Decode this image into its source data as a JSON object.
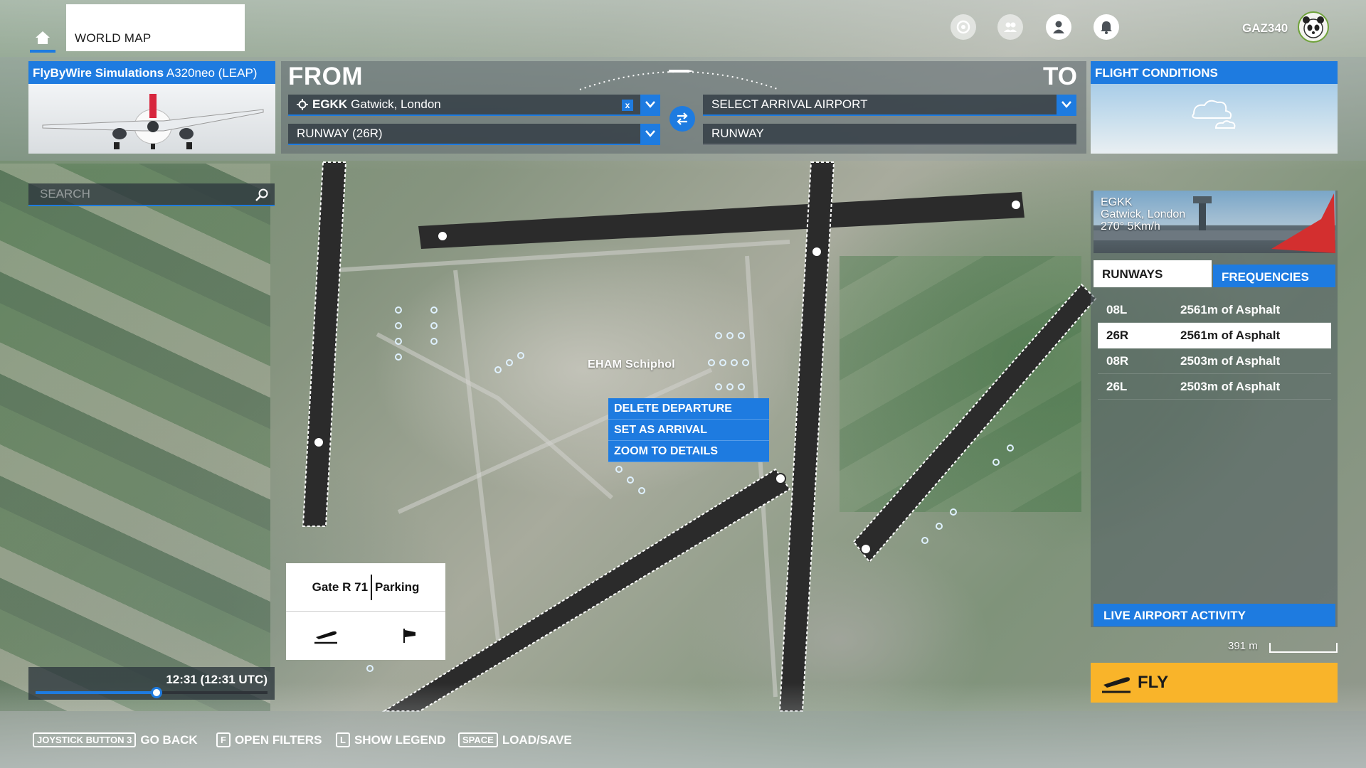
{
  "topbar": {
    "home_icon": "home-icon",
    "section_title": "WORLD MAP",
    "icons": [
      "achievements-icon",
      "friends-icon",
      "profile-icon",
      "notifications-icon"
    ],
    "username": "GAZ340"
  },
  "aircraft": {
    "brand": "FlyByWire Simulations",
    "model": "A320neo (LEAP)"
  },
  "route": {
    "from_label": "FROM",
    "to_label": "TO",
    "departure_code": "EGKK",
    "departure_name": "Gatwick, London",
    "departure_runway": "RUNWAY (26R)",
    "arrival_placeholder": "SELECT ARRIVAL AIRPORT",
    "arrival_runway": "RUNWAY",
    "clear_glyph": "x"
  },
  "conditions": {
    "title": "FLIGHT CONDITIONS"
  },
  "search": {
    "placeholder": "SEARCH"
  },
  "map": {
    "airport_label": "EHAM Schiphol"
  },
  "context_menu": [
    "DELETE DEPARTURE",
    "SET AS ARRIVAL",
    "ZOOM TO DETAILS"
  ],
  "gate": {
    "name": "Gate R 71",
    "type": "Parking"
  },
  "time": {
    "display": "12:31 (12:31 UTC)",
    "slider_fraction": 0.52
  },
  "airport_panel": {
    "code": "EGKK",
    "name": "Gatwick, London",
    "wind": "270° 5Km/h",
    "tab_runways": "RUNWAYS",
    "tab_frequencies": "FREQUENCIES",
    "runways": [
      {
        "id": "08L",
        "desc": "2561m of Asphalt"
      },
      {
        "id": "26R",
        "desc": "2561m of Asphalt"
      },
      {
        "id": "08R",
        "desc": "2503m of Asphalt"
      },
      {
        "id": "26L",
        "desc": "2503m of Asphalt"
      }
    ],
    "live_activity": "LIVE AIRPORT ACTIVITY"
  },
  "scale": {
    "label": "391 m"
  },
  "fly": {
    "label": "FLY"
  },
  "hints": [
    {
      "key": "JOYSTICK BUTTON 3",
      "action": "GO BACK"
    },
    {
      "key": "F",
      "action": "OPEN FILTERS"
    },
    {
      "key": "L",
      "action": "SHOW LEGEND"
    },
    {
      "key": "SPACE",
      "action": "LOAD/SAVE"
    }
  ],
  "colors": {
    "accent": "#1e7be0",
    "fly": "#f9b42a",
    "runway": "#2b2b2b"
  }
}
